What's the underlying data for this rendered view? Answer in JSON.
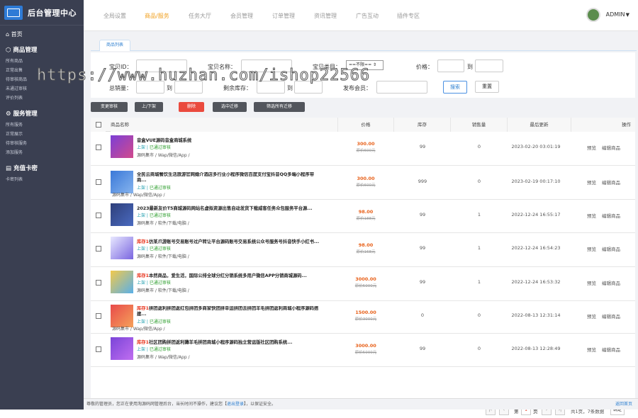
{
  "sidebar": {
    "app_title": "后台管理中心",
    "home": "首页",
    "sections": [
      {
        "title": "商品管理",
        "items": [
          "所有商品",
          "正常出售",
          "待审核商品",
          "未通过审核",
          "评价列表"
        ]
      },
      {
        "title": "服务管理",
        "items": [
          "所有服务",
          "正常展示",
          "待审核服务",
          "添加服务"
        ]
      },
      {
        "title": "充值卡密",
        "items": [
          "卡密列表"
        ]
      }
    ]
  },
  "topnav": {
    "items": [
      "全局设置",
      "商品/服务",
      "任务大厅",
      "会员管理",
      "订单管理",
      "资讯管理",
      "广告互动",
      "插件专区"
    ],
    "active": "商品/服务"
  },
  "user": {
    "name": "ADMIN"
  },
  "tab": {
    "label": "商品列表"
  },
  "filter": {
    "id_label": "宝贝ID：",
    "name_label": "宝贝名称：",
    "type_label": "宝贝类目：",
    "type_value": "==不限==",
    "price_label": "价格：",
    "to": "到",
    "total_label": "总销量：",
    "stock_label": "剩余库存：",
    "member_label": "发布会员：",
    "search": "搜索",
    "reset": "重置"
  },
  "actions": [
    "变更审核",
    "上/下架",
    "删除",
    "选中迁移",
    "筛选所有迁移"
  ],
  "table": {
    "headers": [
      "商品名称",
      "价格",
      "库存",
      "销售量",
      "最后更新",
      "操作"
    ],
    "rows": [
      {
        "tag": "",
        "title": "音盒VUE源码音盒商城系统",
        "status": "上架",
        "audit": "已通过审核",
        "category": "源码集市 / Wap/微信/App /",
        "price": "300.00",
        "orig": "原价600元",
        "stock": "99",
        "sales": "0",
        "updated": "2023-02-20 03:01:19"
      },
      {
        "tag": "",
        "title": "全民云商城餐饮生活旅游官网婚介酒店多行业小程序微信百度支付宝抖音QQ多端小程序带商...",
        "status": "上架",
        "audit": "已通过审核",
        "category": "源码集市 / Wap/微信/App /",
        "price": "300.00",
        "orig": "原价600元",
        "stock": "999",
        "sales": "0",
        "updated": "2023-02-19 00:17:10"
      },
      {
        "tag": "",
        "title": "2023最新友价T5商城源码网站名虚拟资源出售自动发货下载威客任务众包服务平台源...",
        "status": "上架",
        "audit": "已通过审核",
        "category": "源码集市 / 软件/下载/电脑 /",
        "price": "98.00",
        "orig": "原价188元",
        "stock": "99",
        "sales": "1",
        "updated": "2022-12-24 16:55:17"
      },
      {
        "tag": "库存1",
        "title": "仿某爪游账号交易账号过户转让平台源码账号交易系统公众号服务号抖音快手小红书...",
        "status": "上架",
        "audit": "已通过审核",
        "category": "源码集市 / 软件/下载/电脑 /",
        "price": "98.00",
        "orig": "原价168元",
        "stock": "99",
        "sales": "1",
        "updated": "2022-12-24 16:54:23"
      },
      {
        "tag": "库存1",
        "title": "本然商品，爱生活，国际公排全球分红分销系统多用户微信APP分销商城源码...",
        "status": "上架",
        "audit": "已通过审核",
        "category": "源码集市 / 软件/下载/电脑 /",
        "price": "3000.00",
        "orig": "原价5000元",
        "stock": "99",
        "sales": "1",
        "updated": "2022-12-24 16:53:32"
      },
      {
        "tag": "库存1",
        "title": "拼团返利拼团返红包拼团多商家快团拼幸运拼团去拼团羊毛拼团返利商城小程序源码搭建...",
        "status": "上架",
        "audit": "已通过审核",
        "category": "源码集市 / Wap/微信/App /",
        "price": "1500.00",
        "orig": "原价3000元",
        "stock": "0",
        "sales": "0",
        "updated": "2022-08-13 12:31:14"
      },
      {
        "tag": "库存1",
        "title": "社区团购拼团返利薅羊毛拼团商城小程序源码独立营运版社区团购系统...",
        "status": "上架",
        "audit": "已通过审核",
        "category": "源码集市 / Wap/微信/App /",
        "price": "3000.00",
        "orig": "原价5000元",
        "stock": "99",
        "sales": "0",
        "updated": "2022-08-13 12:28:49"
      }
    ],
    "ops": [
      "预览",
      "编辑商品"
    ]
  },
  "pager": {
    "first": "|‹",
    "prev": "‹",
    "page_prefix": "第",
    "page": "1",
    "page_suffix": "页",
    "next": "›",
    "last": "›|",
    "summary": "共1页，7条数据",
    "confirm": "确定"
  },
  "footer": {
    "text": "尊敬的管理员，您正在使用淘源码网管理后台，当长时间不操作，建议您【",
    "link": "退出登录",
    "text2": "】，以保证安全。",
    "back": "返回首页"
  },
  "watermark": "https://www.huzhan.com/ishop22566"
}
